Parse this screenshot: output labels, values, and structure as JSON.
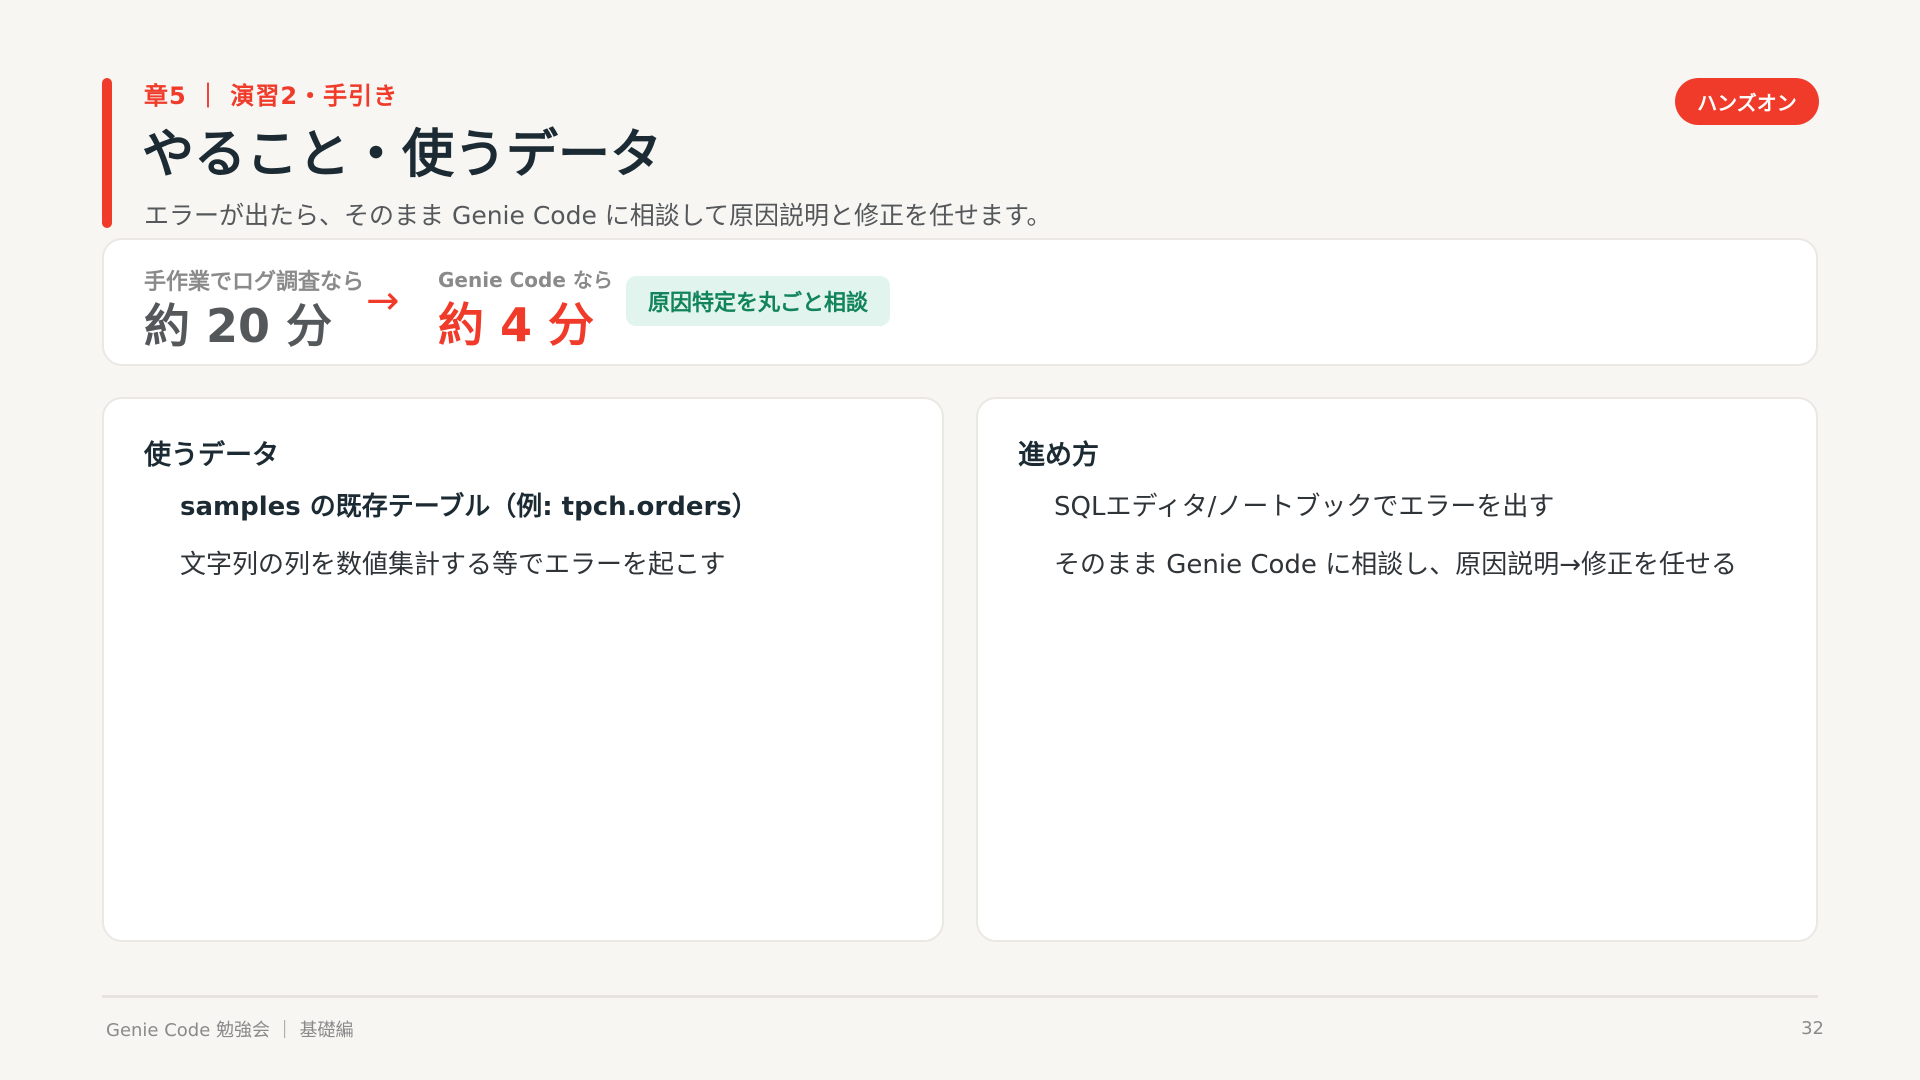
{
  "header": {
    "eyebrow": "章5 ｜ 演習2・手引き",
    "title": "やること・使うデータ",
    "subtitle": "エラーが出たら、そのまま Genie Code に相談して原因説明と修正を任せます。",
    "tag": "ハンズオン"
  },
  "stats": {
    "old_label": "手作業でログ調査なら",
    "old_value": "約 20 分",
    "arrow": "→",
    "new_label": "Genie Code なら",
    "new_value": "約 4 分",
    "badge": "原因特定を丸ごと相談"
  },
  "panels": {
    "data": {
      "title": "使うデータ",
      "items": [
        "samples の既存テーブル（例: tpch.orders）",
        "文字列の列を数値集計する等でエラーを起こす"
      ]
    },
    "steps": {
      "title": "進め方",
      "items": [
        "SQLエディタ/ノートブックでエラーを出す",
        "そのまま Genie Code に相談し、原因説明→修正を任せる"
      ]
    }
  },
  "footer": {
    "text": "Genie Code 勉強会 ｜ 基礎編",
    "page": "32"
  },
  "colors": {
    "accent": "#f03a2a",
    "green": "#11845b",
    "green_bg": "#e2f4ee",
    "background": "#f7f6f3"
  }
}
